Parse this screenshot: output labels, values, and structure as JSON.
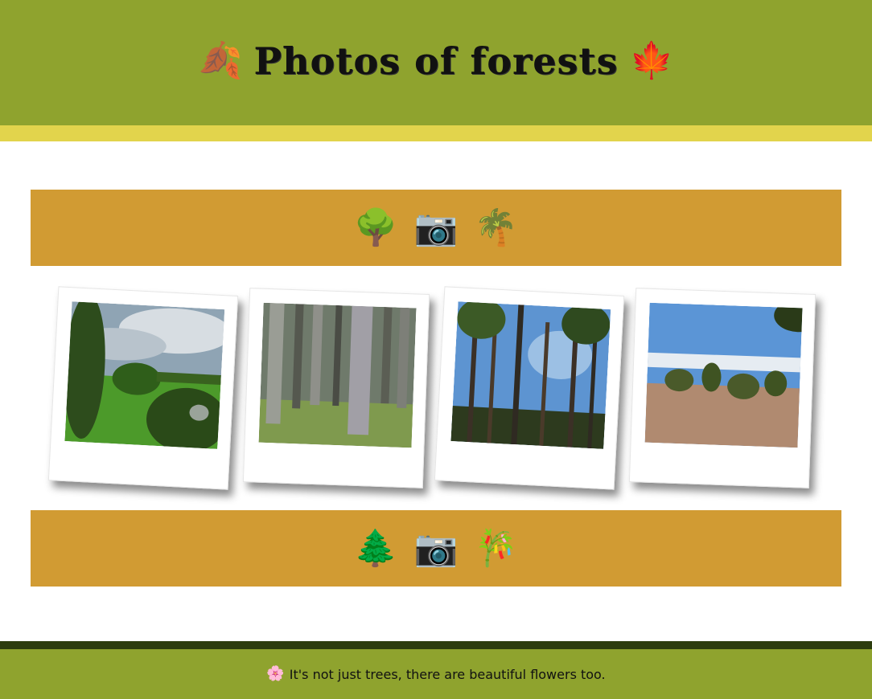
{
  "header": {
    "title": "Photos of forests",
    "left_icon": "🍂",
    "right_icon": "🍁",
    "colors": {
      "background": "#8fa32e",
      "stripe": "#e2d44c"
    }
  },
  "band_top": {
    "icons": [
      "🌳",
      "📷",
      "🌴"
    ],
    "color": "#d19b33"
  },
  "gallery": {
    "photos": [
      {
        "name": "green-field-photo"
      },
      {
        "name": "tree-trunks-photo"
      },
      {
        "name": "tall-pines-photo"
      },
      {
        "name": "mountain-pines-photo"
      }
    ]
  },
  "band_bottom": {
    "icons": [
      "🌲",
      "📷",
      "🎋"
    ],
    "color": "#d19b33"
  },
  "footer": {
    "icon": "🌸",
    "text": "It's not just trees, there are beautiful flowers too.",
    "colors": {
      "background": "#8fa32e",
      "stripe": "#2c3d0f"
    }
  }
}
